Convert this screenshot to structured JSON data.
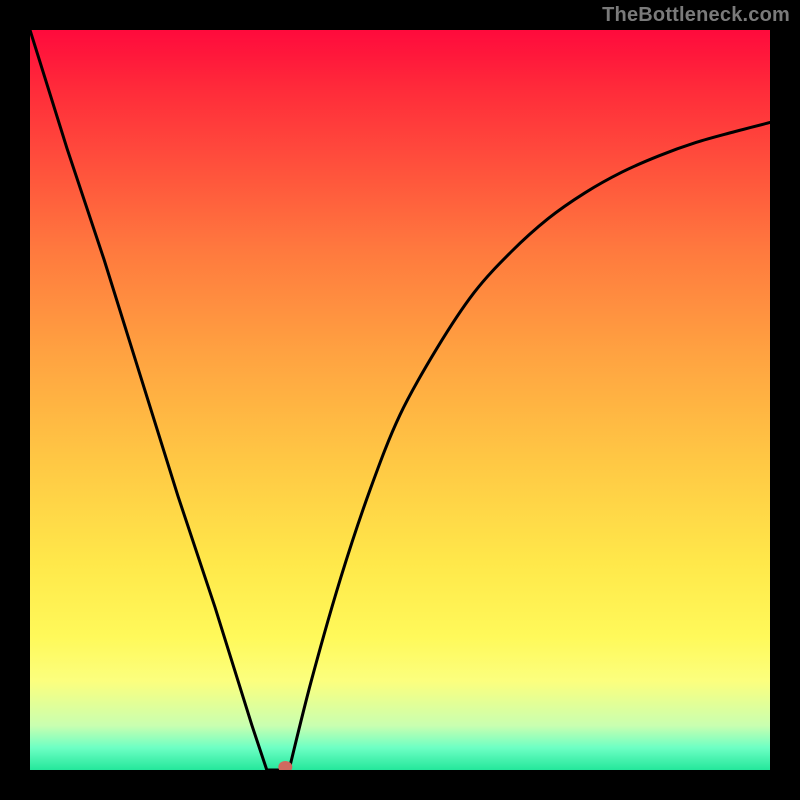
{
  "watermark": "TheBottleneck.com",
  "chart_data": {
    "type": "line",
    "title": "",
    "xlabel": "",
    "ylabel": "",
    "xlim": [
      0,
      1
    ],
    "ylim": [
      0,
      1
    ],
    "left_branch": {
      "x": [
        0.0,
        0.05,
        0.1,
        0.15,
        0.2,
        0.25,
        0.3,
        0.32
      ],
      "y": [
        1.0,
        0.84,
        0.69,
        0.53,
        0.37,
        0.22,
        0.06,
        0.0
      ]
    },
    "dip": {
      "x": [
        0.32,
        0.335,
        0.35
      ],
      "y": [
        0.0,
        0.0,
        0.0
      ]
    },
    "right_branch": {
      "x": [
        0.35,
        0.38,
        0.42,
        0.46,
        0.5,
        0.55,
        0.6,
        0.65,
        0.7,
        0.75,
        0.8,
        0.85,
        0.9,
        0.95,
        1.0
      ],
      "y": [
        0.0,
        0.12,
        0.26,
        0.38,
        0.48,
        0.57,
        0.645,
        0.7,
        0.745,
        0.78,
        0.808,
        0.83,
        0.848,
        0.862,
        0.875
      ]
    },
    "marker": {
      "x": 0.345,
      "y": 0.004
    },
    "marker_color": "#d06a5f",
    "curve_color": "#000000"
  }
}
